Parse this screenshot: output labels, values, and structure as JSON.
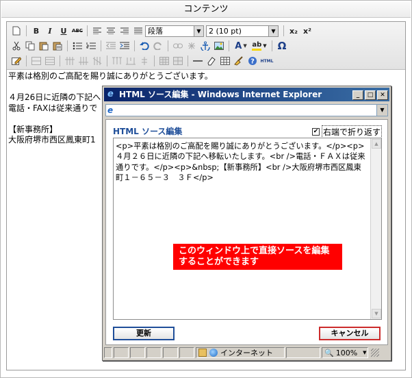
{
  "header": {
    "title": "コンテンツ"
  },
  "toolbar": {
    "paragraph_select": "段落",
    "size_select": "2 (10 pt)",
    "html_label": "HTML",
    "subscript": "x₂",
    "superscript": "x²",
    "bold": "B",
    "italic": "I",
    "underline": "U",
    "strike": "ABC",
    "omega": "Ω",
    "font_color": "A",
    "highlight": "ab"
  },
  "editor": {
    "lines": [
      "平素は格別のご高配を賜り誠にありがとうございます。",
      "",
      "４月26日に近隣の下記へ",
      "電話・FAXは従来通りで",
      "",
      "【新事務所】",
      "大阪府堺市西区鳳東町1"
    ]
  },
  "ie_window": {
    "title": "HTML ソース編集 - Windows Internet Explorer",
    "source_heading": "HTML ソース編集",
    "wrap_label": "右端で折り返す",
    "source_text": "<p>平素は格別のご高配を賜り誠にありがとうございます。</p><p>４月２６日に近隣の下記へ移転いたします。<br />電話・ＦＡＸは従来通りです。</p><p>&nbsp;【新事務所】<br />大阪府堺市西区鳳東町１－６５－３　３Ｆ</p>",
    "callout": "このウィンドウ上で直接ソースを編集することができます",
    "update_button": "更新",
    "cancel_button": "キャンセル",
    "status_zone": "インターネット",
    "zoom": "100%"
  }
}
